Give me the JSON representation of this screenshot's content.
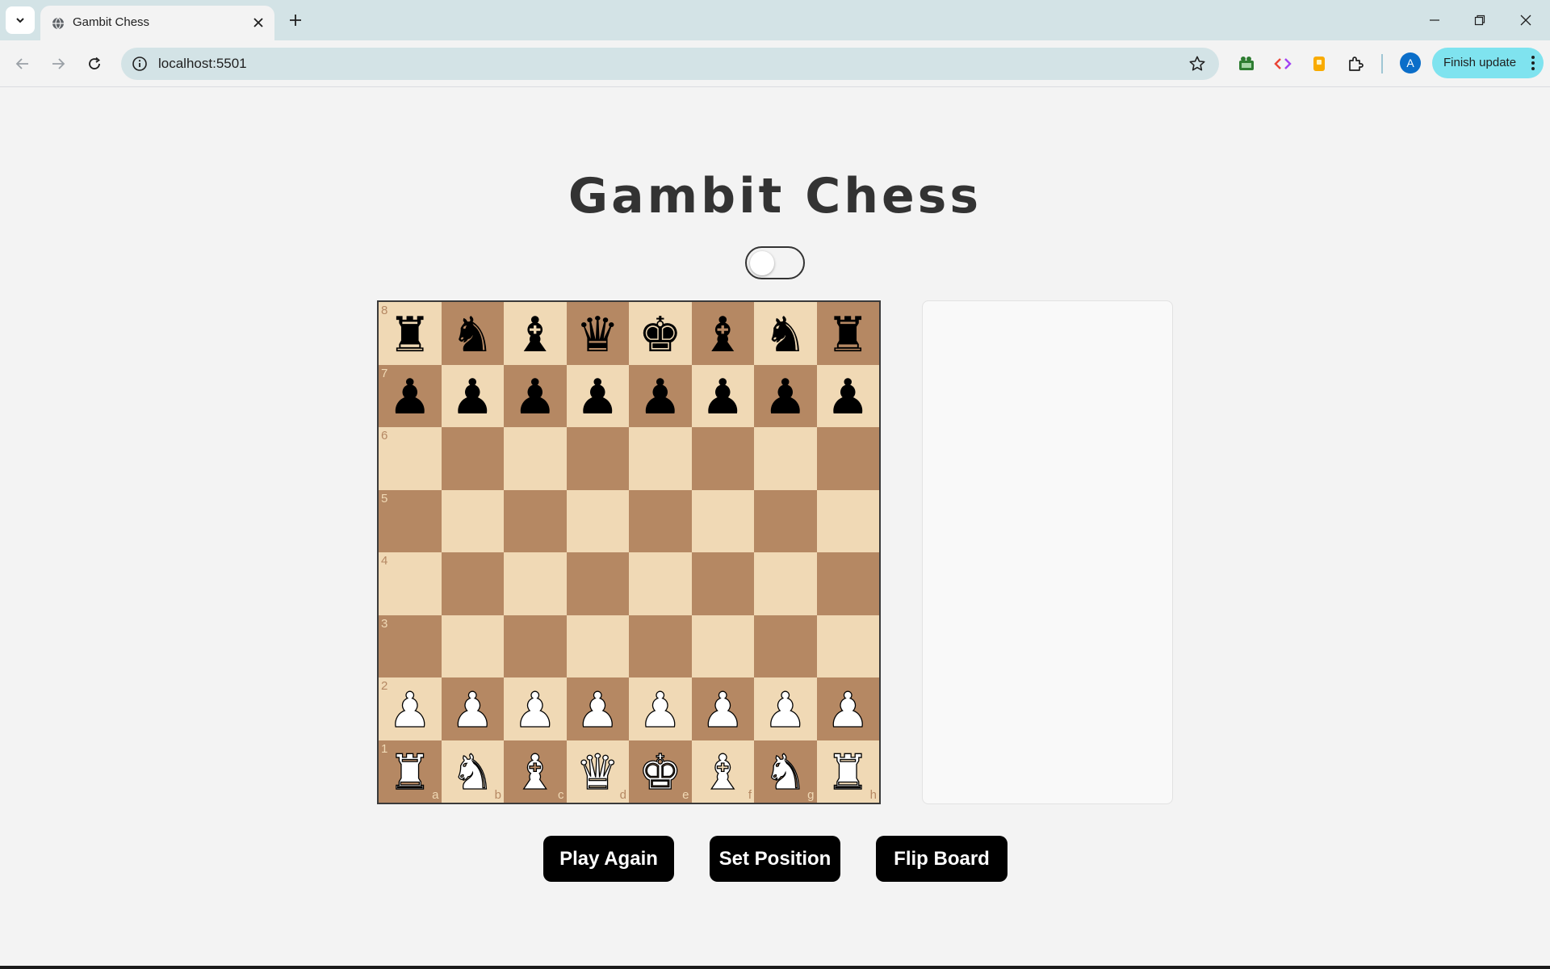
{
  "browser": {
    "tab_title": "Gambit Chess",
    "url": "localhost:5501",
    "profile_initial": "A",
    "finish_update_label": "Finish update",
    "icons": [
      "tab-search-icon",
      "globe-icon",
      "close-icon",
      "plus-icon",
      "minimize-icon",
      "restore-icon",
      "window-close-icon",
      "back-icon",
      "forward-icon",
      "reload-icon",
      "site-info-icon",
      "star-icon",
      "extension-icon",
      "puzzle-icon",
      "more-vertical-icon"
    ]
  },
  "page": {
    "title": "Gambit Chess",
    "theme_toggle_on": false,
    "buttons": {
      "play_again": "Play Again",
      "set_position": "Set Position",
      "flip_board": "Flip Board"
    }
  },
  "board": {
    "colors": {
      "light": "#f0d9b5",
      "dark": "#b58863"
    },
    "ranks": [
      "8",
      "7",
      "6",
      "5",
      "4",
      "3",
      "2",
      "1"
    ],
    "files": [
      "a",
      "b",
      "c",
      "d",
      "e",
      "f",
      "g",
      "h"
    ],
    "position": [
      [
        "r",
        "n",
        "b",
        "q",
        "k",
        "b",
        "n",
        "r"
      ],
      [
        "p",
        "p",
        "p",
        "p",
        "p",
        "p",
        "p",
        "p"
      ],
      [
        "",
        "",
        "",
        "",
        "",
        "",
        "",
        ""
      ],
      [
        "",
        "",
        "",
        "",
        "",
        "",
        "",
        ""
      ],
      [
        "",
        "",
        "",
        "",
        "",
        "",
        "",
        ""
      ],
      [
        "",
        "",
        "",
        "",
        "",
        "",
        "",
        ""
      ],
      [
        "P",
        "P",
        "P",
        "P",
        "P",
        "P",
        "P",
        "P"
      ],
      [
        "R",
        "N",
        "B",
        "Q",
        "K",
        "B",
        "N",
        "R"
      ]
    ]
  }
}
